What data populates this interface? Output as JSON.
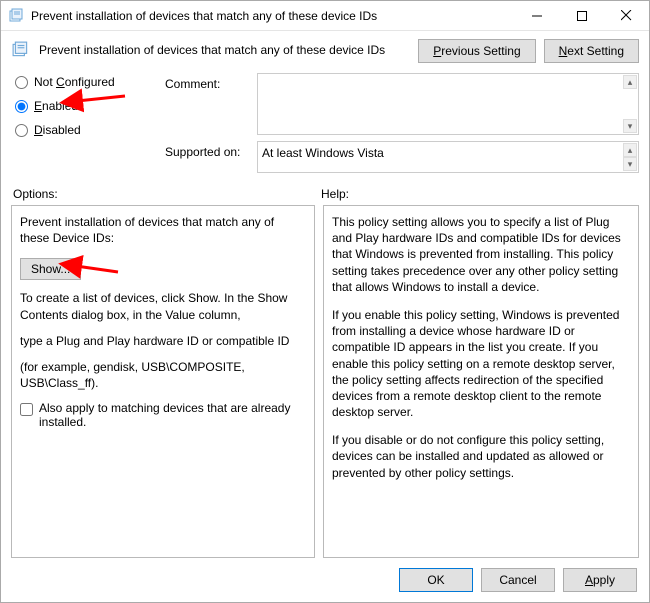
{
  "window": {
    "title": "Prevent installation of devices that match any of these device IDs"
  },
  "header": {
    "title_text": "Prevent installation of devices that match any of these device IDs",
    "previous_label": "Previous Setting",
    "next_label": "Next Setting"
  },
  "state": {
    "not_configured_label": "Not Configured",
    "enabled_label": "Enabled",
    "disabled_label": "Disabled",
    "selected": "enabled"
  },
  "fields": {
    "comment_label": "Comment:",
    "comment_value": "",
    "supported_label": "Supported on:",
    "supported_value": "At least Windows Vista"
  },
  "labels": {
    "options": "Options:",
    "help": "Help:"
  },
  "options_pane": {
    "intro": "Prevent installation of devices that match any of these Device IDs:",
    "show_btn": "Show...",
    "line1": "To create a list of devices, click Show. In the Show Contents dialog box, in the Value column,",
    "line2": "type a Plug and Play hardware ID or compatible ID",
    "line3": "(for example, gendisk, USB\\COMPOSITE, USB\\Class_ff).",
    "checkbox_label": "Also apply to matching devices that are already installed.",
    "checkbox_checked": false
  },
  "help_pane": {
    "p1": "This policy setting allows you to specify a list of Plug and Play hardware IDs and compatible IDs for devices that Windows is prevented from installing. This policy setting takes precedence over any other policy setting that allows Windows to install a device.",
    "p2": "If you enable this policy setting, Windows is prevented from installing a device whose hardware ID or compatible ID appears in the list you create. If you enable this policy setting on a remote desktop server, the policy setting affects redirection of the specified devices from a remote desktop client to the remote desktop server.",
    "p3": "If you disable or do not configure this policy setting, devices can be installed and updated as allowed or prevented by other policy settings."
  },
  "footer": {
    "ok": "OK",
    "cancel": "Cancel",
    "apply": "Apply"
  }
}
